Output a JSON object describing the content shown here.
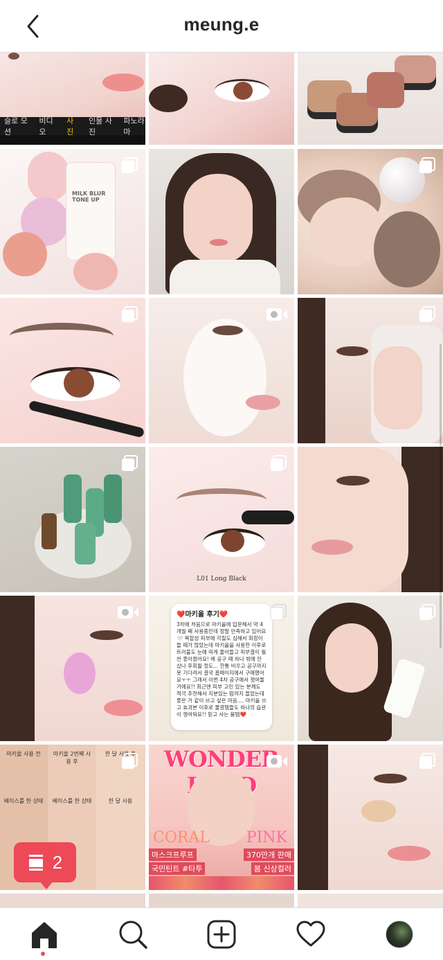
{
  "header": {
    "title": "meung.e",
    "back_icon": "chevron-left-icon"
  },
  "grid": {
    "columns": 3,
    "tiles": [
      {
        "row": 0,
        "col": 0,
        "kind": "photo",
        "desc_colors": [
          "#f6dede",
          "#e9b7b1"
        ],
        "icon": "none"
      },
      {
        "row": 0,
        "col": 1,
        "kind": "photo",
        "desc_colors": [
          "#f3d6d4",
          "#d99b9a"
        ],
        "icon": "none"
      },
      {
        "row": 0,
        "col": 2,
        "kind": "photo",
        "desc_colors": [
          "#efe7e4",
          "#b87a6a"
        ],
        "icon": "none"
      },
      {
        "row": 1,
        "col": 0,
        "kind": "photo",
        "desc_colors": [
          "#f8f0ef",
          "#e9c1bf"
        ],
        "icon": "multi"
      },
      {
        "row": 1,
        "col": 1,
        "kind": "photo",
        "desc_colors": [
          "#ece8e4",
          "#3b2a24"
        ],
        "icon": "none"
      },
      {
        "row": 1,
        "col": 2,
        "kind": "photo",
        "desc_colors": [
          "#f2e0d6",
          "#c9a896"
        ],
        "icon": "multi"
      },
      {
        "row": 2,
        "col": 0,
        "kind": "photo",
        "desc_colors": [
          "#f9e3e1",
          "#7a4d3d"
        ],
        "icon": "multi"
      },
      {
        "row": 2,
        "col": 1,
        "kind": "video",
        "desc_colors": [
          "#f3e7e4",
          "#c9a79e"
        ],
        "icon": "video"
      },
      {
        "row": 2,
        "col": 2,
        "kind": "photo",
        "desc_colors": [
          "#efe4e1",
          "#b89384"
        ],
        "icon": "multi"
      },
      {
        "row": 3,
        "col": 0,
        "kind": "photo",
        "desc_colors": [
          "#d8d6cf",
          "#3f8d6a"
        ],
        "icon": "multi"
      },
      {
        "row": 3,
        "col": 1,
        "kind": "photo",
        "desc_colors": [
          "#f7e4e3",
          "#8a5a4d"
        ],
        "icon": "multi"
      },
      {
        "row": 3,
        "col": 2,
        "kind": "photo",
        "desc_colors": [
          "#f2e5e0",
          "#c8a595"
        ],
        "icon": "none"
      },
      {
        "row": 4,
        "col": 0,
        "kind": "video",
        "desc_colors": [
          "#f5dcd8",
          "#e7a3c7"
        ],
        "icon": "video"
      },
      {
        "row": 4,
        "col": 1,
        "kind": "review",
        "desc_colors": [
          "#f4efe6",
          "#ffffff"
        ],
        "icon": "multi"
      },
      {
        "row": 4,
        "col": 2,
        "kind": "photo",
        "desc_colors": [
          "#ebe5df",
          "#3c2a21"
        ],
        "icon": "multi"
      },
      {
        "row": 5,
        "col": 0,
        "kind": "compare",
        "desc_colors": [
          "#e9c9b5",
          "#b78468"
        ],
        "icon": "multi"
      },
      {
        "row": 5,
        "col": 1,
        "kind": "magazine",
        "desc_colors": [
          "#fbd4cf",
          "#e44a5e"
        ],
        "icon": "video"
      },
      {
        "row": 5,
        "col": 2,
        "kind": "photo",
        "desc_colors": [
          "#f5e3df",
          "#caa08e"
        ],
        "icon": "multi"
      }
    ]
  },
  "tile_text": {
    "camera_modes": [
      "슬로 모션",
      "비디오",
      "사진",
      "인물 사진",
      "파노라마"
    ],
    "camera_selected": "사진",
    "mascara_label": "L01 Long Black",
    "milk_blur_label": "MILK BLUR TONE UP",
    "review_title": "❤️마키올 후기❤️",
    "review_body": "3차에 처음으로 마키올에 입문해서 약 4개월 째 사용중인데 정말 만족하고 있어요 🤍 복합성 피부에 각질도 심해서 화장이 들 때가 많았는데 마키올을 사용한 이후로 트러블도 눈에 띄게 줄어들고 피부결이 훨씬 좋아졌어요! 왜 공구 때 하나 밖에 안 샀나 후회될 정도... 한통 비우고 공구까지 못 기다려서 결국 홈페이지에서 구매했어요ㅜㅜ 그래서 이번 4차 공구에서 쟁여둘 거에요!! 최근엔 피부 고민 있는 분께도 적극 추천해서 지분있는 맘까지 들었는데 좋은 거 같이 쓰고 싶은 마음.... 마키올 쓰고 효과본 이후로 물광템들도 하나의 습관이 쟁여둬요!! 믿고 사는 뮹템❤️",
    "compare_labels": [
      "마키올 사용 전",
      "마키올 2번째 사용 후",
      "한 달 사용 후"
    ],
    "compare_bottom": [
      "베이스를 한 상태",
      "베이스를 한 상태",
      "한 달 사용"
    ],
    "magazine_title": "WONDER LAND",
    "magazine_coral": "CORAL",
    "magazine_pink": "PINK",
    "magazine_left": "마스크프루프",
    "magazine_left2": "국민틴트 #타투",
    "magazine_right": "370만개 판매",
    "magazine_right2": "봄 신상컬러"
  },
  "notification_badge": {
    "icon": "posts-icon",
    "count": "2",
    "color": "#ed4956"
  },
  "tabbar": {
    "items": [
      {
        "name": "home",
        "icon": "home-icon",
        "active": true
      },
      {
        "name": "search",
        "icon": "search-icon",
        "active": false
      },
      {
        "name": "create",
        "icon": "plus-square-icon",
        "active": false
      },
      {
        "name": "activity",
        "icon": "heart-icon",
        "active": false
      },
      {
        "name": "profile",
        "icon": "avatar",
        "active": false
      }
    ]
  }
}
